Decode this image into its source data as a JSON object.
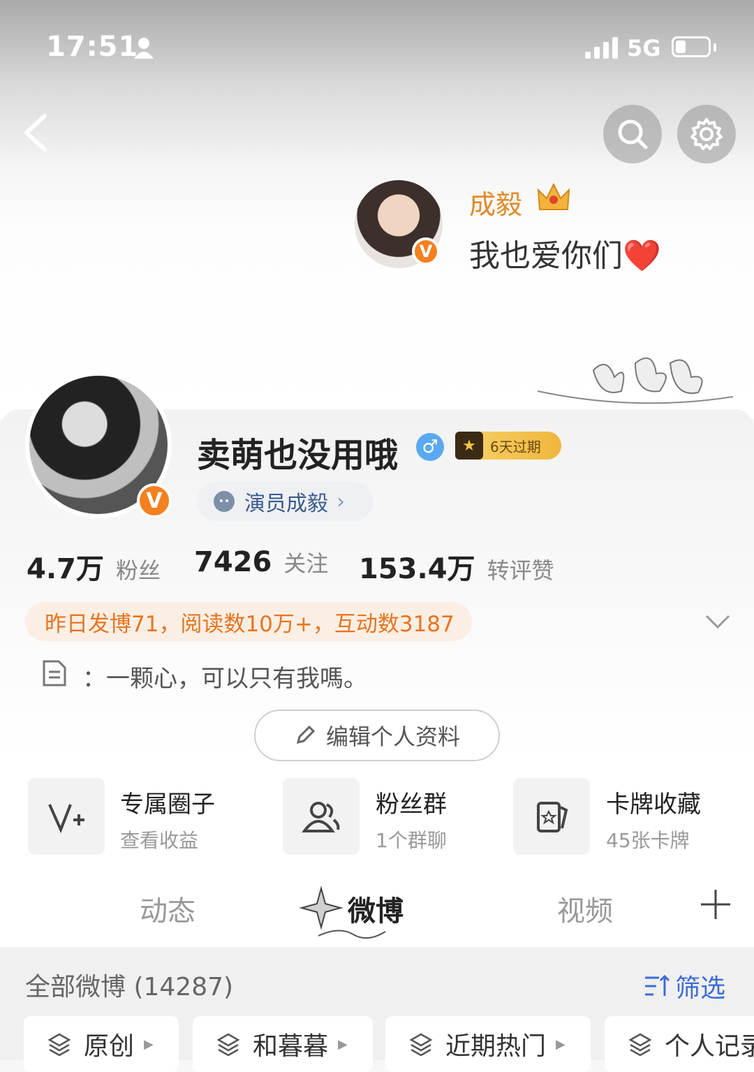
{
  "status_bar": {
    "time": "17:51",
    "network": "5G"
  },
  "pinned_post": {
    "author": "成毅",
    "text": "我也爱你们❤️"
  },
  "profile": {
    "nickname": "卖萌也没用哦",
    "gender_symbol": "♂",
    "vip_label": "6天过期",
    "identity_tag": "演员成毅",
    "stats": [
      {
        "value": "4.7万",
        "label": "粉丝"
      },
      {
        "value": "7426",
        "label": "关注"
      },
      {
        "value": "153.4万",
        "label": "转评赞"
      }
    ],
    "summary": "昨日发博71，阅读数10万+，互动数3187",
    "bio": "一颗心，可以只有我嗎。",
    "edit_button": "编辑个人资料"
  },
  "shortcuts": [
    {
      "title": "专属圈子",
      "subtitle": "查看收益",
      "icon": "v-plus-icon"
    },
    {
      "title": "粉丝群",
      "subtitle": "1个群聊",
      "icon": "group-icon"
    },
    {
      "title": "卡牌收藏",
      "subtitle": "45张卡牌",
      "icon": "card-icon"
    }
  ],
  "tabs": [
    {
      "label": "动态",
      "active": false
    },
    {
      "label": "微博",
      "active": true
    },
    {
      "label": "视频",
      "active": false
    }
  ],
  "feed": {
    "header": "全部微博 (14287)",
    "filter_label": "筛选",
    "chips": [
      "原创",
      "和暮暮",
      "近期热门",
      "个人记录"
    ]
  },
  "colors": {
    "accent_orange": "#e8741e",
    "link_blue": "#3d6bd6",
    "verified_orange": "#f4801f"
  }
}
